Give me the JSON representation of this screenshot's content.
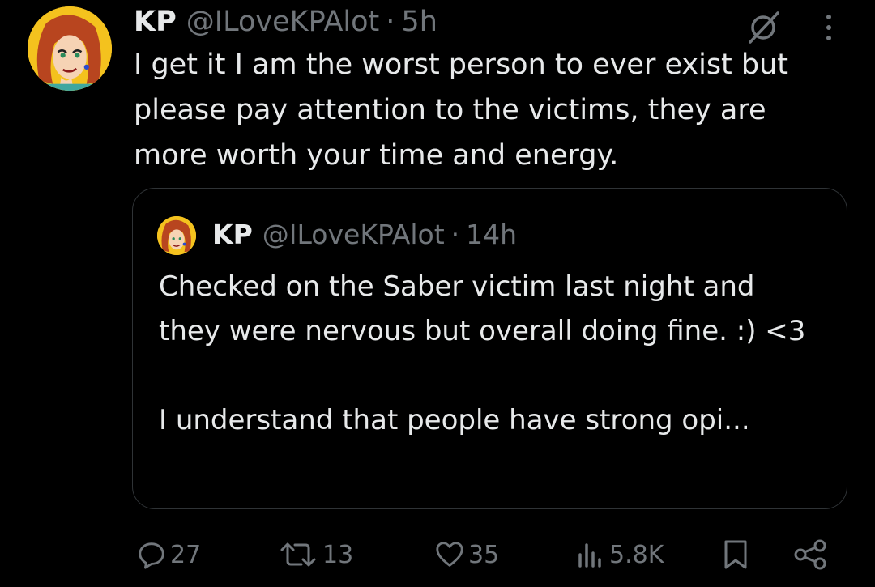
{
  "tweet": {
    "author_name": "KP",
    "handle": "@ILoveKPAlot",
    "separator": "·",
    "time": "5h",
    "text": "I get it I am the worst person to ever exist but please pay attention to the victims, they are more worth your time and energy."
  },
  "quote": {
    "author_name": "KP",
    "handle": "@ILoveKPAlot",
    "separator": "·",
    "time": "14h",
    "text_line1": "Checked on the Saber victim last night and they were nervous but overall doing fine. :) <3",
    "text_line2": "I understand that people have strong opi..."
  },
  "actions": {
    "replies": "27",
    "reposts": "13",
    "likes": "35",
    "views": "5.8K"
  },
  "icons": [
    "grok-icon",
    "more-icon",
    "reply-icon",
    "repost-icon",
    "like-icon",
    "views-icon",
    "bookmark-icon",
    "share-icon"
  ],
  "colors": {
    "background": "#000000",
    "text": "#e7e9ea",
    "secondary": "#71767b",
    "border": "#2f3336"
  }
}
